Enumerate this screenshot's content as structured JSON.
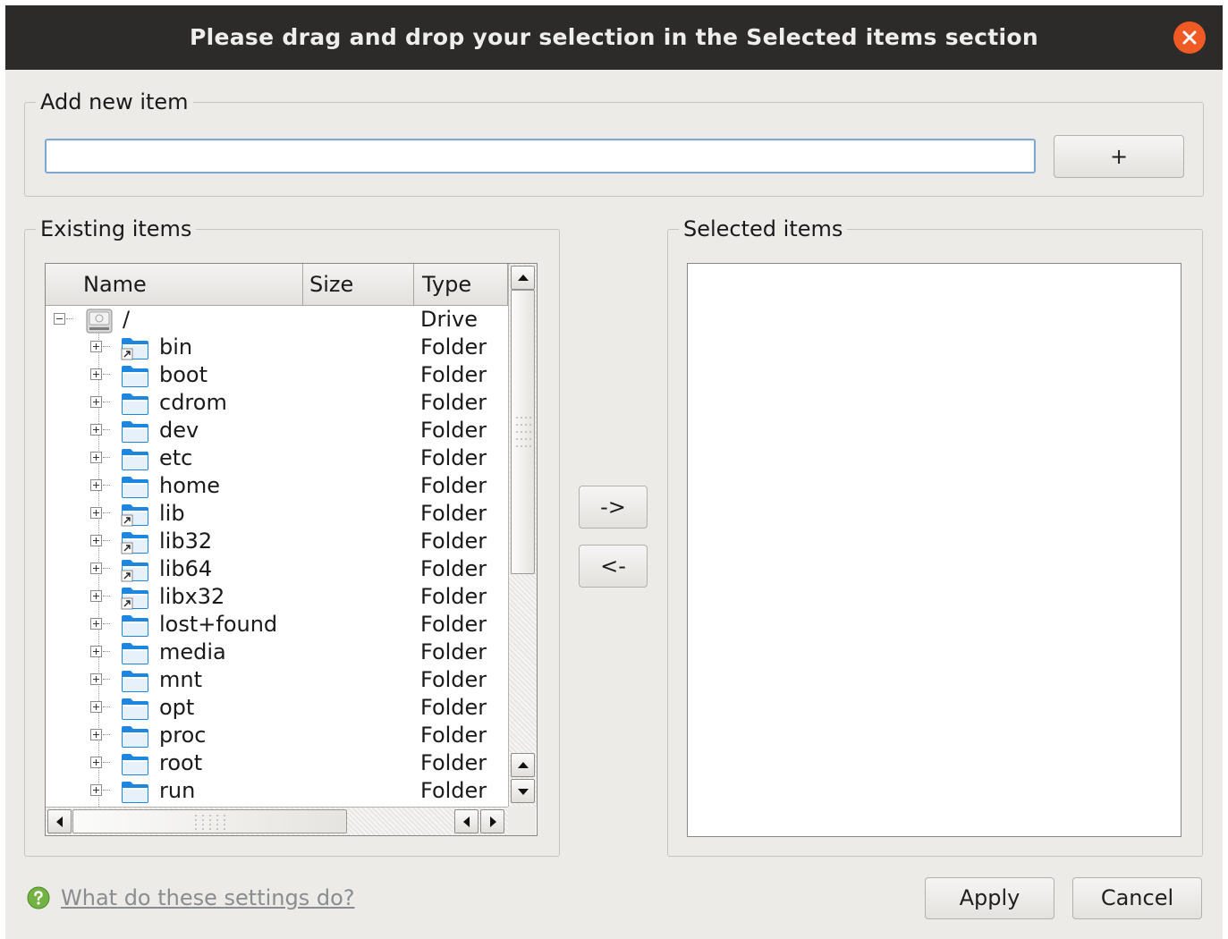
{
  "window": {
    "title": "Please drag and drop your selection in the Selected items section",
    "close_icon": "close-icon"
  },
  "add_section": {
    "title": "Add new item",
    "input_value": "",
    "add_button": "+"
  },
  "existing_section": {
    "title": "Existing items",
    "columns": [
      "Name",
      "Size",
      "Type"
    ],
    "rows": [
      {
        "name": "/",
        "size": "",
        "type": "Drive",
        "icon": "drive-icon",
        "level": 0,
        "expanded": true
      },
      {
        "name": "bin",
        "size": "",
        "type": "Folder",
        "icon": "folder-link-icon",
        "level": 1
      },
      {
        "name": "boot",
        "size": "",
        "type": "Folder",
        "icon": "folder-icon",
        "level": 1
      },
      {
        "name": "cdrom",
        "size": "",
        "type": "Folder",
        "icon": "folder-icon",
        "level": 1
      },
      {
        "name": "dev",
        "size": "",
        "type": "Folder",
        "icon": "folder-icon",
        "level": 1
      },
      {
        "name": "etc",
        "size": "",
        "type": "Folder",
        "icon": "folder-icon",
        "level": 1
      },
      {
        "name": "home",
        "size": "",
        "type": "Folder",
        "icon": "folder-icon",
        "level": 1
      },
      {
        "name": "lib",
        "size": "",
        "type": "Folder",
        "icon": "folder-link-icon",
        "level": 1
      },
      {
        "name": "lib32",
        "size": "",
        "type": "Folder",
        "icon": "folder-link-icon",
        "level": 1
      },
      {
        "name": "lib64",
        "size": "",
        "type": "Folder",
        "icon": "folder-link-icon",
        "level": 1
      },
      {
        "name": "libx32",
        "size": "",
        "type": "Folder",
        "icon": "folder-link-icon",
        "level": 1
      },
      {
        "name": "lost+found",
        "size": "",
        "type": "Folder",
        "icon": "folder-icon",
        "level": 1
      },
      {
        "name": "media",
        "size": "",
        "type": "Folder",
        "icon": "folder-icon",
        "level": 1
      },
      {
        "name": "mnt",
        "size": "",
        "type": "Folder",
        "icon": "folder-icon",
        "level": 1
      },
      {
        "name": "opt",
        "size": "",
        "type": "Folder",
        "icon": "folder-icon",
        "level": 1
      },
      {
        "name": "proc",
        "size": "",
        "type": "Folder",
        "icon": "folder-icon",
        "level": 1
      },
      {
        "name": "root",
        "size": "",
        "type": "Folder",
        "icon": "folder-icon",
        "level": 1
      },
      {
        "name": "run",
        "size": "",
        "type": "Folder",
        "icon": "folder-icon",
        "level": 1
      }
    ]
  },
  "transfer": {
    "add_button": "->",
    "remove_button": "<-"
  },
  "selected_section": {
    "title": "Selected items",
    "items": []
  },
  "footer": {
    "help_link": "What do these settings do?",
    "apply_button": "Apply",
    "cancel_button": "Cancel"
  },
  "colors": {
    "titlebar": "#2c2b29",
    "close_button": "#f05a24",
    "folder": "#1c86e0",
    "help_icon": "#73b343"
  }
}
